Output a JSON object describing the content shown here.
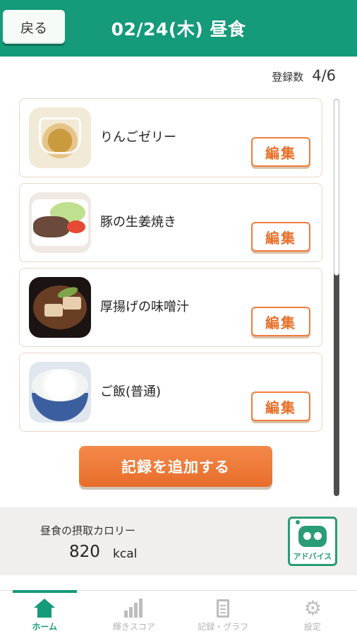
{
  "header": {
    "back_label": "戻る",
    "title": "02/24(木) 昼食"
  },
  "count": {
    "label": "登録数",
    "value": "4/6"
  },
  "foods": [
    {
      "name": "りんごゼリー",
      "edit_label": "編集"
    },
    {
      "name": "豚の生姜焼き",
      "edit_label": "編集"
    },
    {
      "name": "厚揚げの味噌汁",
      "edit_label": "編集"
    },
    {
      "name": "ご飯(普通)",
      "edit_label": "編集"
    }
  ],
  "add_button_label": "記録を追加する",
  "calorie": {
    "label": "昼食の摂取カロリー",
    "value": "820",
    "unit": "kcal"
  },
  "advice": {
    "label": "アドバイス",
    "icon": "robot-icon"
  },
  "nav": [
    {
      "label": "ホーム",
      "icon": "home-icon",
      "active": true
    },
    {
      "label": "輝きスコア",
      "icon": "bar-chart-icon",
      "active": false
    },
    {
      "label": "記録・グラフ",
      "icon": "clipboard-icon",
      "active": false
    },
    {
      "label": "設定",
      "icon": "gear-icon",
      "active": false
    }
  ],
  "colors": {
    "brand_green": "#159a7a",
    "accent_orange": "#e86d2a"
  }
}
